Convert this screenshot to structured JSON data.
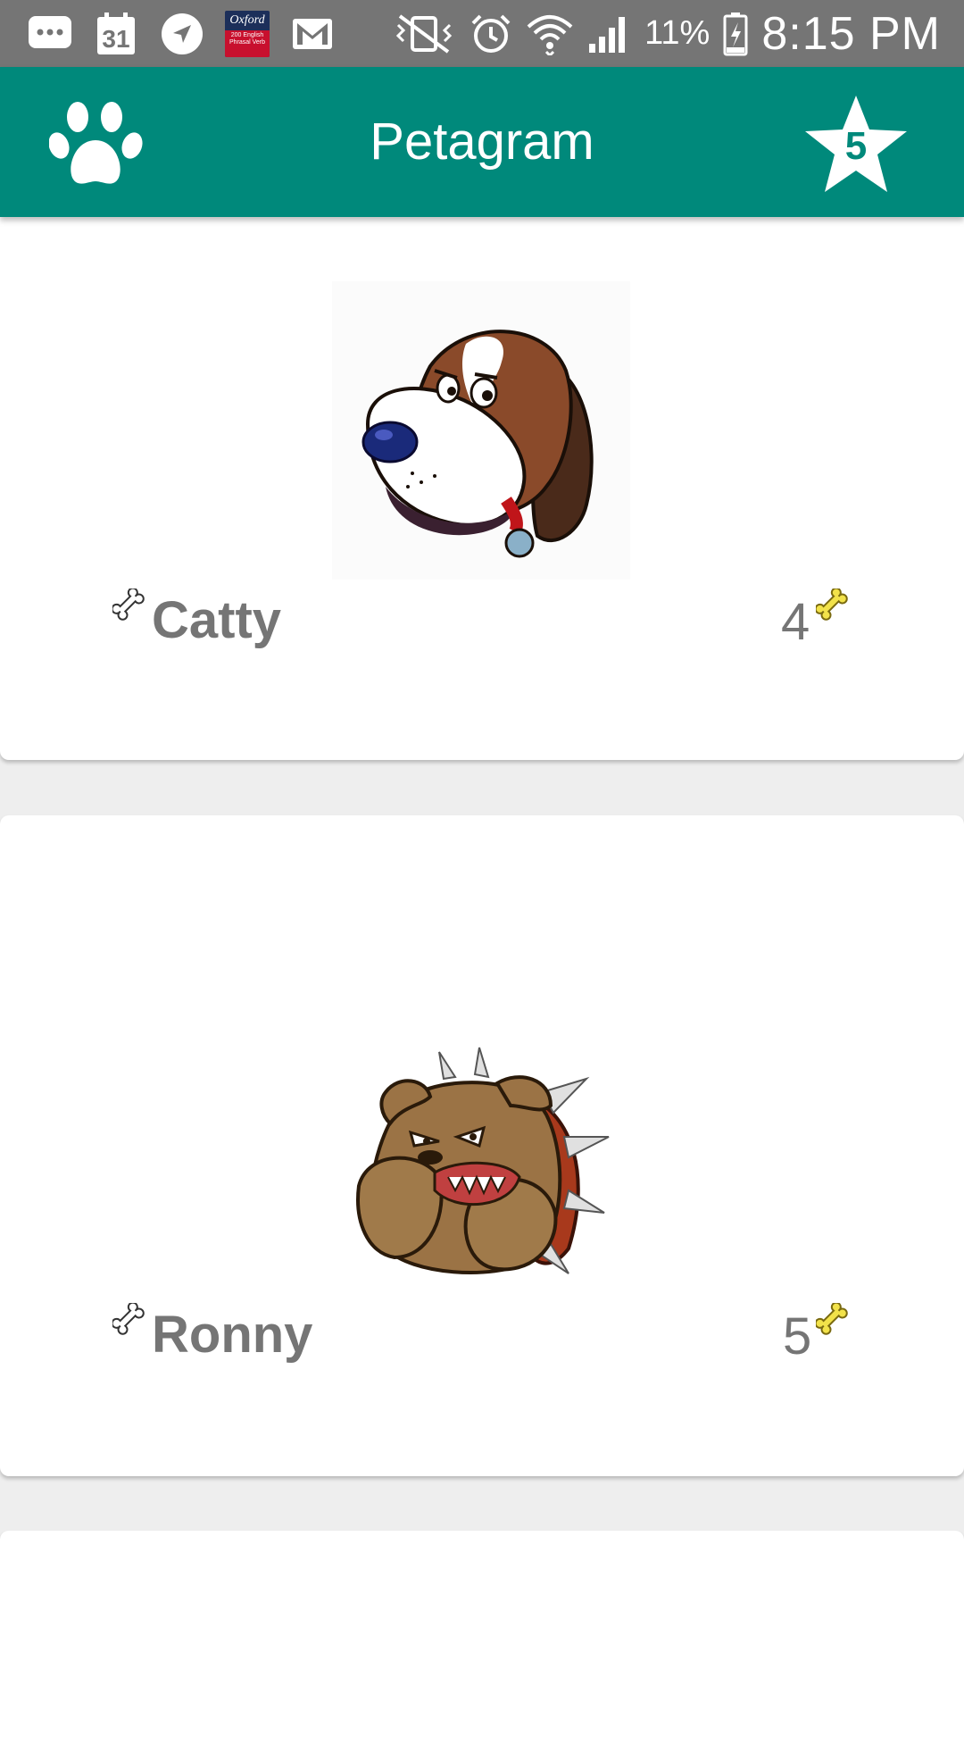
{
  "status_bar": {
    "calendar_day": "31",
    "oxford_title": "Oxford",
    "oxford_subtitle": "200 English Phrasal Verb",
    "battery": "11%",
    "time": "8:15 PM"
  },
  "app_bar": {
    "title": "Petagram",
    "favorites_count": "5"
  },
  "pets": [
    {
      "name": "Catty",
      "rating": "4",
      "photo": "beagle-dog-cartoon"
    },
    {
      "name": "Ronny",
      "rating": "5",
      "photo": "bulldog-cartoon"
    },
    {
      "name": "",
      "rating": "",
      "photo": ""
    }
  ],
  "colors": {
    "primary": "#00897b",
    "status_bar": "#757575",
    "text_gray": "#757575",
    "bone_yellow": "#f2e24a"
  }
}
